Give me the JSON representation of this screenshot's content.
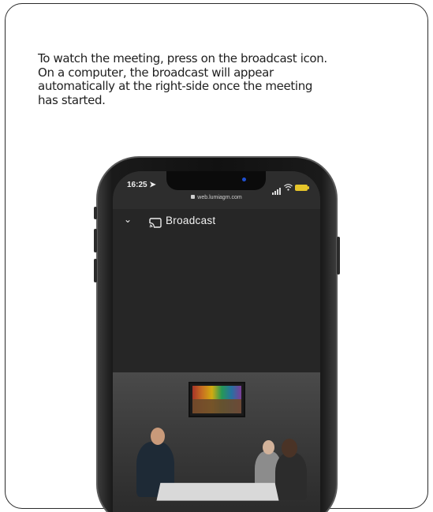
{
  "instructions": {
    "line1": "To watch the meeting, press on the broadcast icon.",
    "line2": "On a computer, the broadcast will appear",
    "line3": "automatically at the right-side once the meeting",
    "line4": "has started."
  },
  "phone": {
    "status_time": "16:25",
    "url": "web.lumiagm.com",
    "appbar": {
      "back_icon": "chevron-down-icon",
      "cast_icon": "cast-icon",
      "title": "Broadcast"
    }
  },
  "colors": {
    "screen_bg": "#262626",
    "battery": "#e6c52a",
    "notch_dot": "#1f4fd0"
  }
}
